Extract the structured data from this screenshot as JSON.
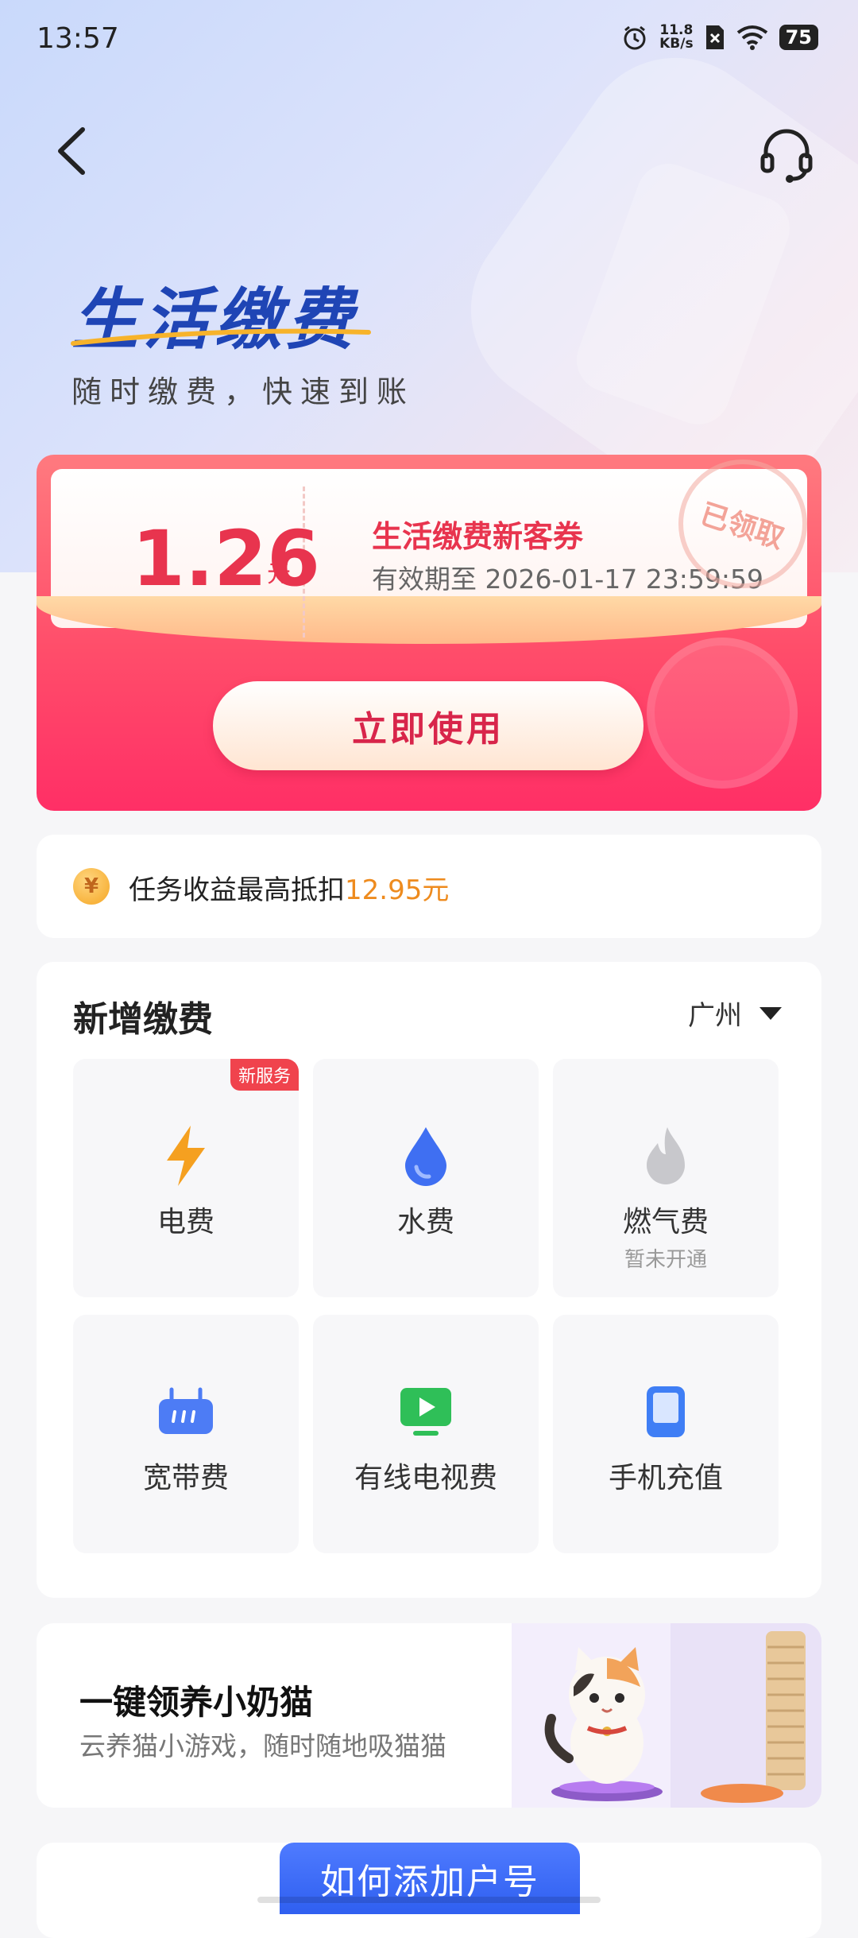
{
  "status_bar": {
    "time": "13:57",
    "net_speed_value": "11.8",
    "net_speed_unit": "KB/s",
    "battery": "75"
  },
  "header": {
    "title": "生活缴费",
    "subtitle": "随时缴费，快速到账"
  },
  "coupon": {
    "amount": "1.26",
    "unit": "元",
    "name": "生活缴费新客券",
    "validity": "有效期至 2026-01-17 23:59:59",
    "stamp": "已领取",
    "use_button": "立即使用"
  },
  "task": {
    "coin_symbol": "¥",
    "text": "任务收益最高抵扣",
    "amount": "12.95元"
  },
  "pay": {
    "title": "新增缴费",
    "city": "广州",
    "items": [
      {
        "label": "电费",
        "badge": "新服务",
        "icon": "lightning-icon",
        "color": "#f5a020"
      },
      {
        "label": "水费",
        "icon": "water-drop-icon",
        "color": "#3f6ff2"
      },
      {
        "label": "燃气费",
        "sub": "暂未开通",
        "icon": "flame-icon",
        "color": "#c8c8cc"
      },
      {
        "label": "宽带费",
        "icon": "broadband-icon",
        "color": "#4d7cf5"
      },
      {
        "label": "有线电视费",
        "icon": "tv-icon",
        "color": "#2fbf58"
      },
      {
        "label": "手机充值",
        "icon": "phone-icon",
        "color": "#3f7ef5"
      }
    ]
  },
  "cat_card": {
    "title": "一键领养小奶猫",
    "desc": "云养猫小游戏，随时随地吸猫猫"
  },
  "bottom": {
    "howto_button": "如何添加户号"
  }
}
